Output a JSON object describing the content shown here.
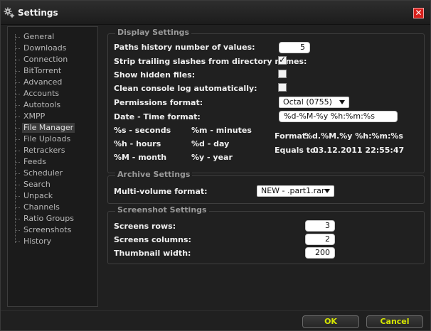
{
  "window": {
    "title": "Settings"
  },
  "sidebar": {
    "items": [
      {
        "label": "General"
      },
      {
        "label": "Downloads"
      },
      {
        "label": "Connection"
      },
      {
        "label": "BitTorrent"
      },
      {
        "label": "Advanced"
      },
      {
        "label": "Accounts"
      },
      {
        "label": "Autotools"
      },
      {
        "label": "XMPP"
      },
      {
        "label": "File Manager",
        "selected": true
      },
      {
        "label": "File Uploads"
      },
      {
        "label": "Retrackers"
      },
      {
        "label": "Feeds"
      },
      {
        "label": "Scheduler"
      },
      {
        "label": "Search"
      },
      {
        "label": "Unpack"
      },
      {
        "label": "Channels"
      },
      {
        "label": "Ratio Groups"
      },
      {
        "label": "Screenshots"
      },
      {
        "label": "History"
      }
    ]
  },
  "display": {
    "legend": "Display Settings",
    "paths_history_label": "Paths history number of values:",
    "paths_history_value": "5",
    "strip_slashes_label": "Strip trailing slashes from directory names:",
    "strip_slashes_checked": true,
    "show_hidden_label": "Show hidden files:",
    "show_hidden_checked": false,
    "clean_console_label": "Clean console log automatically:",
    "clean_console_checked": false,
    "permissions_label": "Permissions format:",
    "permissions_value": "Octal (0755)",
    "datetime_label": "Date - Time format:",
    "datetime_value": "%d-%M-%y %h:%m:%s",
    "legend_s": "%s - seconds",
    "legend_m": "%m - minutes",
    "legend_h": "%h - hours",
    "legend_d": "%d - day",
    "legend_M": "%M - month",
    "legend_y": "%y - year",
    "format_label": "Format:",
    "format_value": "%d.%M.%y %h:%m:%s",
    "equals_label": "Equals to:",
    "equals_value": "03.12.2011 22:55:47"
  },
  "archive": {
    "legend": "Archive Settings",
    "multivolume_label": "Multi-volume format:",
    "multivolume_value": "NEW - .part1.rar"
  },
  "screenshot": {
    "legend": "Screenshot Settings",
    "rows_label": "Screens rows:",
    "rows_value": "3",
    "columns_label": "Screens columns:",
    "columns_value": "2",
    "thumb_label": "Thumbnail width:",
    "thumb_value": "200"
  },
  "buttons": {
    "ok": "OK",
    "cancel": "Cancel"
  },
  "colors": {
    "close": "#d8201c",
    "button_text": "#d6e600"
  }
}
